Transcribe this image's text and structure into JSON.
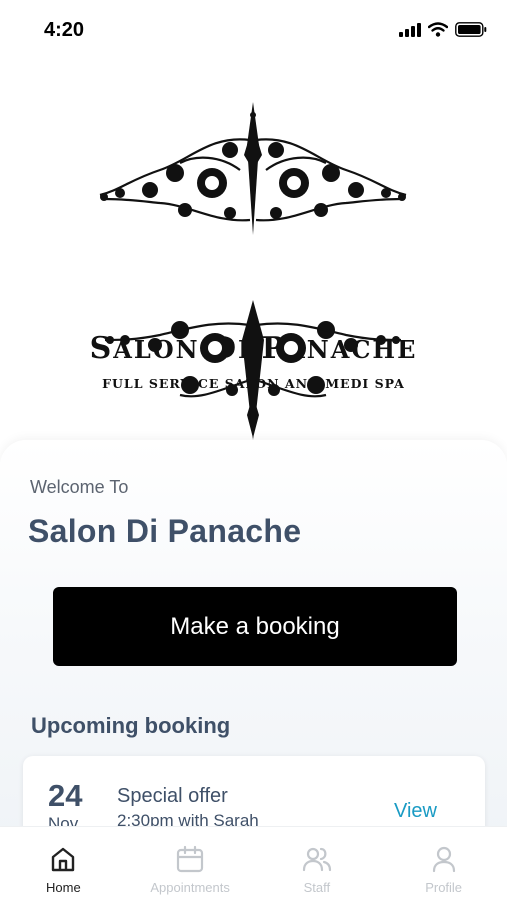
{
  "status_bar": {
    "time": "4:20"
  },
  "logo": {
    "title_first": "S",
    "title_rest": "ALON ",
    "title_d": "D",
    "title_i": "I ",
    "title_p": "P",
    "title_anache": "ANACHE",
    "subtitle": "FULL SERVICE SALON AND MEDI SPA"
  },
  "welcome": {
    "label": "Welcome To",
    "salon_name": "Salon Di Panache"
  },
  "booking_button": {
    "label": "Make a booking"
  },
  "upcoming": {
    "title": "Upcoming booking",
    "day": "24",
    "month": "Nov",
    "offer": "Special offer",
    "detail": "2:30pm with Sarah",
    "view": "View"
  },
  "tabs": [
    {
      "label": "Home",
      "icon": "home-icon",
      "active": true
    },
    {
      "label": "Appointments",
      "icon": "calendar-icon",
      "active": false
    },
    {
      "label": "Staff",
      "icon": "staff-icon",
      "active": false
    },
    {
      "label": "Profile",
      "icon": "profile-icon",
      "active": false
    }
  ],
  "colors": {
    "accent": "#1a9bc4",
    "heading": "#3f5068",
    "button": "#000000"
  }
}
